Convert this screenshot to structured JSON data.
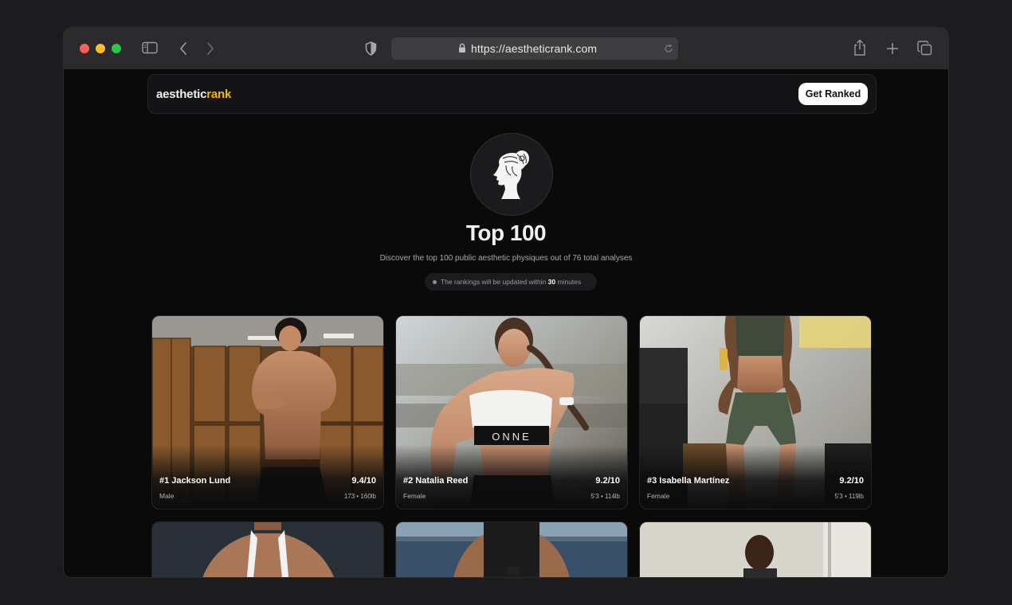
{
  "browser": {
    "url": "https://aestheticrank.com"
  },
  "site": {
    "logo_part1": "aesthetic",
    "logo_part2": "rank",
    "cta_label": "Get Ranked"
  },
  "hero": {
    "title": "Top 100",
    "subtitle": "Discover the top 100 public aesthetic physiques out of 76 total analyses",
    "update_prefix": "The rankings will be updated within ",
    "update_value": "30",
    "update_suffix": " minutes"
  },
  "cards": [
    {
      "name": "#1 Jackson Lund",
      "score": "9.4/10",
      "gender": "Male",
      "stats": "173 • 160lb"
    },
    {
      "name": "#2 Natalia Reed",
      "score": "9.2/10",
      "gender": "Female",
      "stats": "5'3 • 114lb"
    },
    {
      "name": "#3 Isabella Martínez",
      "score": "9.2/10",
      "gender": "Female",
      "stats": "5'3 • 119lb"
    }
  ],
  "colors": {
    "accent": "#f5b800",
    "background": "#0a0a0b",
    "toolbar": "#2b2b2d"
  },
  "icons": [
    "sidebar-icon",
    "back-icon",
    "forward-icon",
    "shield-icon",
    "lock-icon",
    "reload-icon",
    "share-icon",
    "new-tab-icon",
    "tabs-icon",
    "greek-bust-icon"
  ]
}
